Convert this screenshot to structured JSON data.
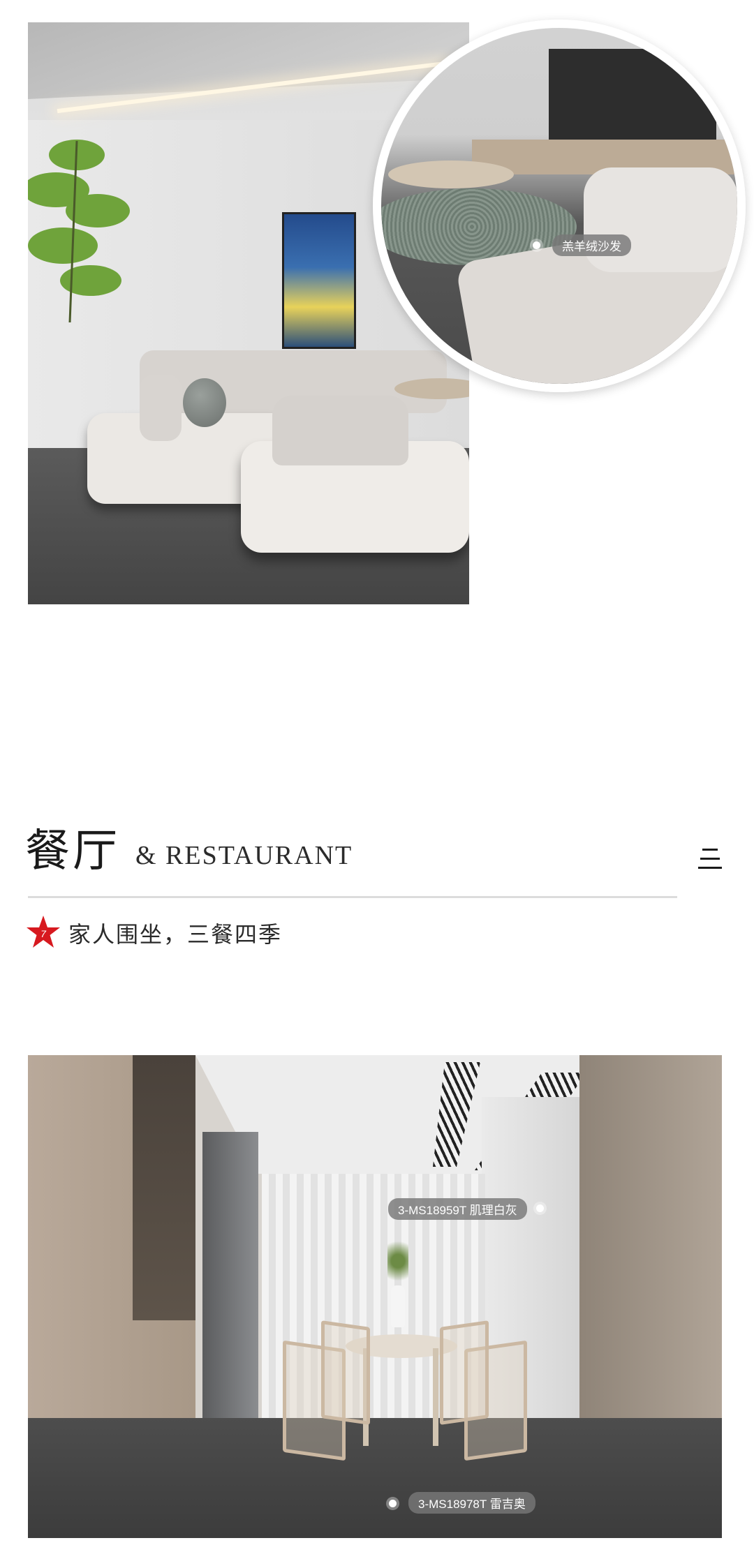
{
  "living_room": {
    "tag_label": "羔羊绒沙发"
  },
  "section": {
    "title": "餐厅",
    "subtitle": "& RESTAURANT",
    "tagline": "家人围坐，三餐四季"
  },
  "restaurant": {
    "tag_top": "3-MS18959T 肌理白灰",
    "tag_bottom": "3-MS18978T 雷吉奥"
  },
  "colors": {
    "accent_star": "#d7191f",
    "divider": "#dcdcdc",
    "tag_bg": "#787878"
  },
  "icons": {
    "menu": "menu-icon",
    "star": "star-icon"
  }
}
